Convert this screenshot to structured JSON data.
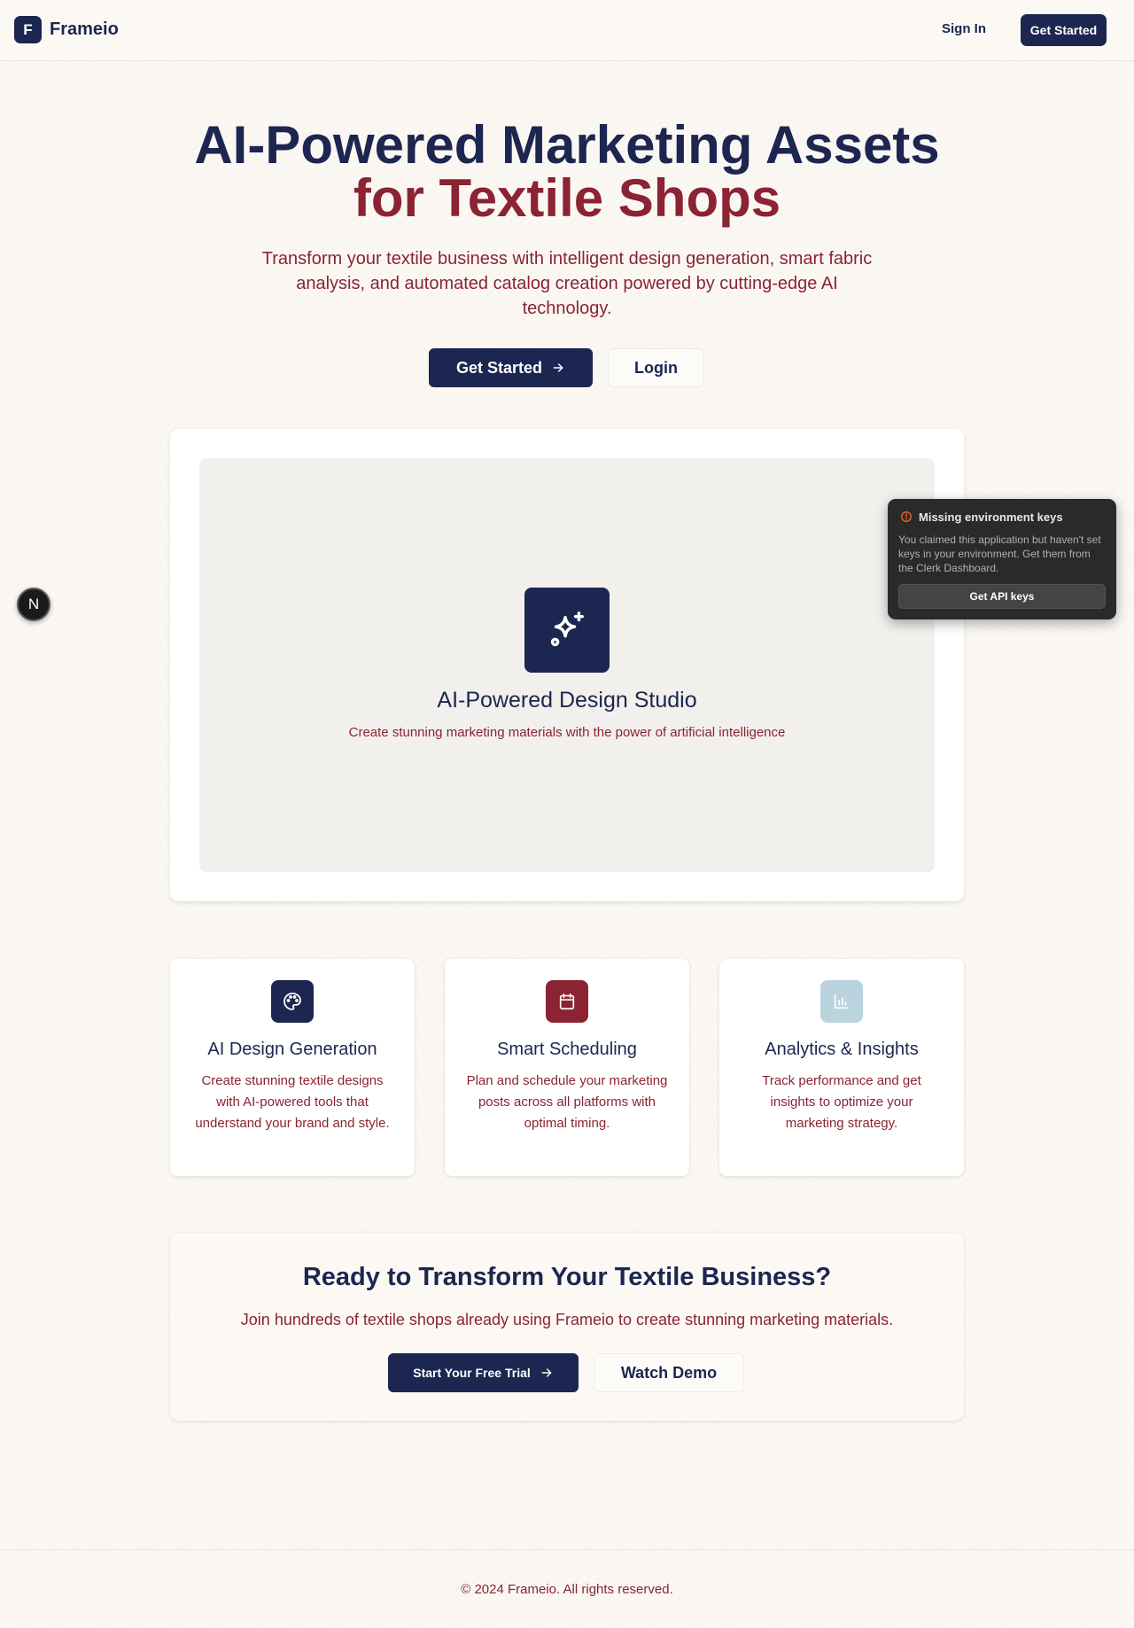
{
  "nav": {
    "logo_letter": "F",
    "brand": "Frameio",
    "sign_in": "Sign In",
    "get_started": "Get Started"
  },
  "hero": {
    "title_line1": "AI-Powered Marketing Assets",
    "title_line2": "for Textile Shops",
    "subtitle": "Transform your textile business with intelligent design generation, smart fabric analysis, and automated catalog creation powered by cutting-edge AI technology.",
    "primary_button": "Get Started",
    "secondary_button": "Login"
  },
  "showcase": {
    "icon": "sparkles-icon",
    "title": "AI-Powered Design Studio",
    "subtitle": "Create stunning marketing materials with the power of artificial intelligence"
  },
  "toast": {
    "title": "Missing environment keys",
    "body": "You claimed this application but haven't set keys in your environment. Get them from the Clerk Dashboard.",
    "button": "Get API keys"
  },
  "dev_badge": "N",
  "features": [
    {
      "icon": "palette-icon",
      "icon_color": "#1c2650",
      "title": "AI Design Generation",
      "description": "Create stunning textile designs with AI-powered tools that understand your brand and style."
    },
    {
      "icon": "calendar-icon",
      "icon_color": "#8b2332",
      "title": "Smart Scheduling",
      "description": "Plan and schedule your marketing posts across all platforms with optimal timing."
    },
    {
      "icon": "bar-chart-icon",
      "icon_color": "#b9d3df",
      "title": "Analytics & Insights",
      "description": "Track performance and get insights to optimize your marketing strategy."
    }
  ],
  "cta": {
    "title": "Ready to Transform Your Textile Business?",
    "subtitle": "Join hundreds of textile shops already using Frameio to create stunning marketing materials.",
    "primary_button": "Start Your Free Trial",
    "secondary_button": "Watch Demo"
  },
  "footer": {
    "text": "© 2024 Frameio. All rights reserved."
  },
  "colors": {
    "navy": "#1c2650",
    "maroon": "#8b2332",
    "background": "#fbf8f4"
  }
}
